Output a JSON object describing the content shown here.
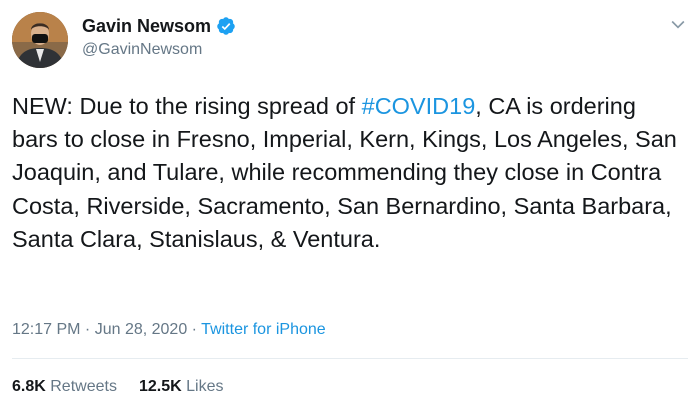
{
  "author": {
    "display_name": "Gavin Newsom",
    "handle": "@GavinNewsom",
    "verified": true
  },
  "tweet": {
    "text_before": "NEW: Due to the rising spread of ",
    "hashtag": "#COVID19",
    "text_after": ", CA is ordering bars to close in Fresno, Imperial, Kern, Kings, Los Angeles, San Joaquin, and Tulare, while recommending they close in Contra Costa, Riverside, Sacramento, San Bernardino, Santa Barbara, Santa Clara, Stanislaus, & Ventura."
  },
  "meta": {
    "time": "12:17 PM",
    "sep1": " · ",
    "date": "Jun 28, 2020",
    "sep2": " · ",
    "source": "Twitter for iPhone"
  },
  "stats": {
    "retweets_count": "6.8K",
    "retweets_label": "Retweets",
    "likes_count": "12.5K",
    "likes_label": "Likes"
  },
  "colors": {
    "link": "#1b95e0",
    "muted": "#657786",
    "text": "#14171a",
    "verified": "#1da1f2"
  },
  "icons": {
    "verified": "verified-badge-icon",
    "menu": "chevron-down-icon"
  }
}
